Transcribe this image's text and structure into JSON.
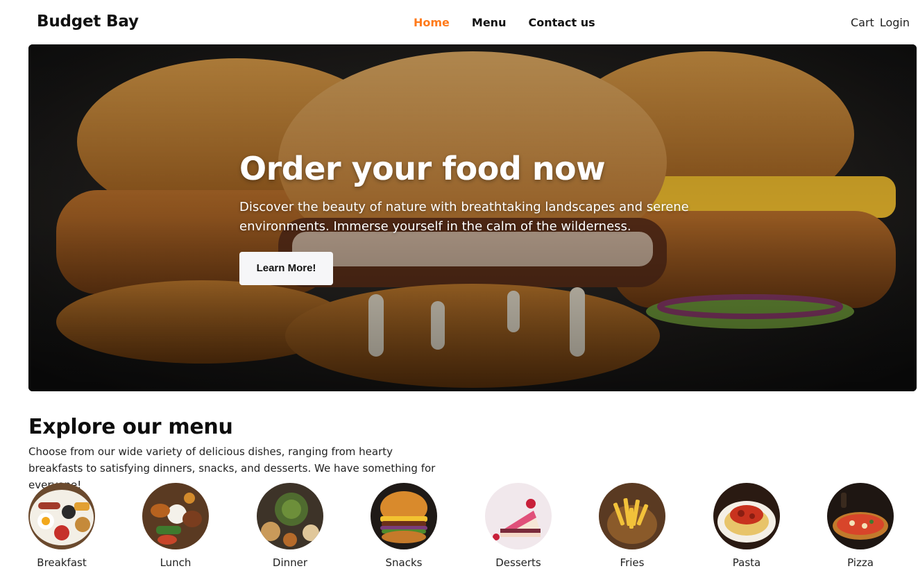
{
  "brand": "Budget Bay",
  "nav": {
    "links": [
      "Home",
      "Menu",
      "Contact us"
    ],
    "active": "Home",
    "cart_label": "Cart",
    "login_label": "Login"
  },
  "hero": {
    "title": "Order your food now",
    "text": "Discover the beauty of nature with breathtaking landscapes and serene environments. Immerse yourself in the calm of the wilderness.",
    "button_label": "Learn More!"
  },
  "explore": {
    "title": "Explore our menu",
    "text": "Choose from our wide variety of delicious dishes, ranging from hearty breakfasts to satisfying dinners, snacks, and desserts. We have something for everyone!"
  },
  "menu_items": [
    {
      "label": "Breakfast"
    },
    {
      "label": "Lunch"
    },
    {
      "label": "Dinner"
    },
    {
      "label": "Snacks"
    },
    {
      "label": "Desserts"
    },
    {
      "label": "Fries"
    },
    {
      "label": "Pasta"
    },
    {
      "label": "Pizza"
    }
  ],
  "colors": {
    "accent": "#ff7a1a",
    "text": "#111111",
    "button_bg": "#f6f6f8"
  }
}
